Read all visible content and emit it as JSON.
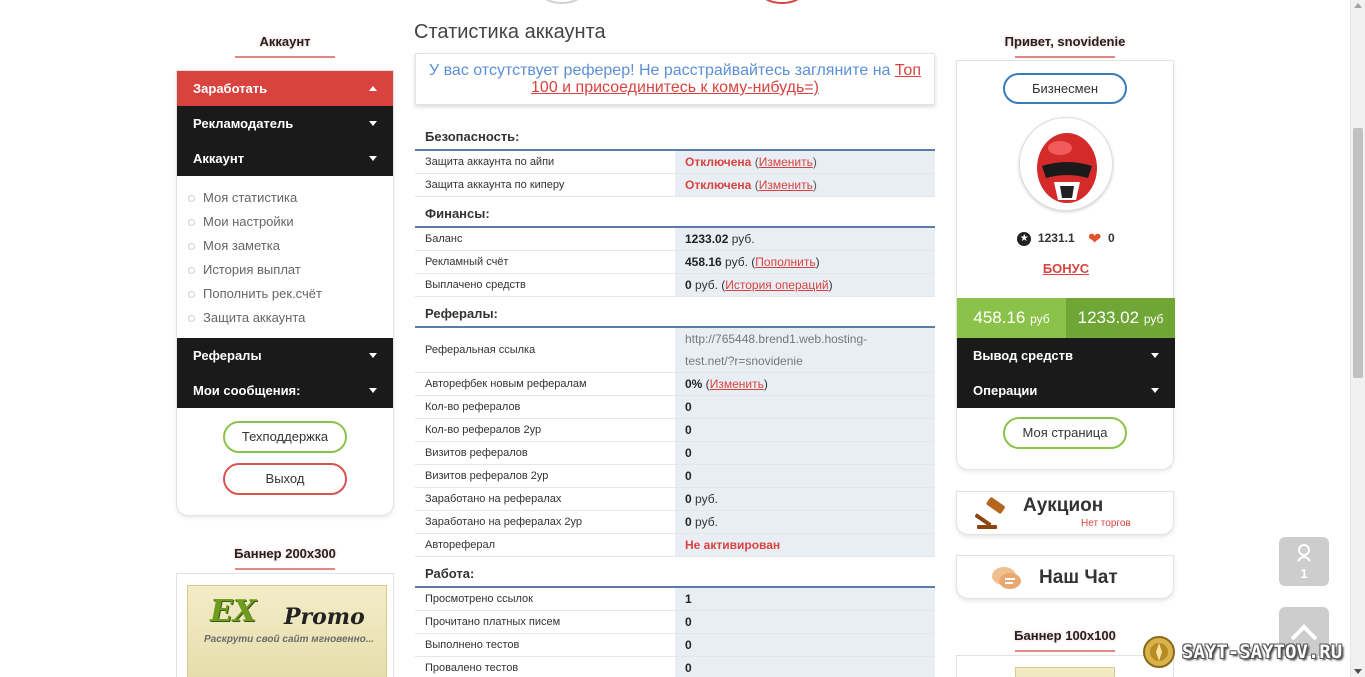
{
  "left": {
    "title": "Аккаунт",
    "menu": [
      {
        "label": "Заработать",
        "active": true
      },
      {
        "label": "Рекламодатель",
        "active": false
      },
      {
        "label": "Аккаунт",
        "active": false
      }
    ],
    "submenu": [
      "Моя статистика",
      "Мои настройки",
      "Моя заметка",
      "История выплат",
      "Пополнить рек.счёт",
      "Защита аккаунта"
    ],
    "menu2": [
      {
        "label": "Рефералы"
      },
      {
        "label": "Мои сообщения:"
      }
    ],
    "support_btn": "Техподдержка",
    "logout_btn": "Выход",
    "banner_title": "Баннер 200x300",
    "banner": {
      "ex": "EX",
      "promo": "Promo",
      "tagline": "Раскрути свой сайт мгновенно..."
    }
  },
  "center": {
    "title": "Статистика аккаунта",
    "notice_text": "У вас отсутствует реферер! Не расстрайвайтесь загляните на",
    "notice_link": "Топ 100 и присоединитесь к кому-нибудь=)",
    "security": {
      "title": "Безопасность:",
      "ip_label": "Защита аккаунта по айпи",
      "ip_status": "Отключена",
      "keeper_label": "Защита аккаунта по киперу",
      "keeper_status": "Отключена",
      "change": "Изменить"
    },
    "finance": {
      "title": "Финансы:",
      "balance_label": "Баланс",
      "balance_value": "1233.02",
      "ad_label": "Рекламный счёт",
      "ad_value": "458.16",
      "topup": "Пополнить",
      "paid_label": "Выплачено средств",
      "paid_value": "0",
      "history": "История операций",
      "currency": "руб."
    },
    "referrals": {
      "title": "Рефералы:",
      "link_label": "Реферальная ссылка",
      "link_line1": "http://765448.brend1.web.hosting-",
      "link_line2": "test.net/?r=snovidenie",
      "rows": [
        {
          "label": "Авторефбек новым рефералам",
          "value": "0%"
        },
        {
          "label": "Кол-во рефералов",
          "value": "0"
        },
        {
          "label": "Кол-во рефералов 2ур",
          "value": "0"
        },
        {
          "label": "Визитов рефералов",
          "value": "0"
        },
        {
          "label": "Визитов рефералов 2ур",
          "value": "0"
        },
        {
          "label": "Заработано на рефералах",
          "value": "0"
        },
        {
          "label": "Заработано на рефералах 2ур",
          "value": "0"
        }
      ],
      "autoref_label": "Автореферал",
      "autoref_status": "Не активирован"
    },
    "work": {
      "title": "Работа:",
      "rows": [
        {
          "label": "Просмотрено ссылок",
          "value": "1"
        },
        {
          "label": "Прочитано платных писем",
          "value": "0"
        },
        {
          "label": "Выполнено тестов",
          "value": "0"
        },
        {
          "label": "Провалено тестов",
          "value": "0"
        }
      ]
    }
  },
  "right": {
    "greeting": "Привет, snovidenie",
    "status_btn": "Бизнесмен",
    "rating": "1231.1",
    "likes": "0",
    "bonus": "БОНУС",
    "bal_ad": "458.16",
    "bal_main": "1233.02",
    "currency": "руб",
    "withdraw": "Вывод средств",
    "operations": "Операции",
    "my_page": "Моя страница",
    "auction_title": "Аукцион",
    "auction_sub": "Нет торгов",
    "chat_title": "Наш Чат",
    "banner100_title": "Баннер 100x100",
    "online_count": "1"
  },
  "watermark": "SAYT-SAYTOV.RU",
  "colors": {
    "accent_red": "#d9433f",
    "green": "#8bc34a",
    "dark_menu": "#1a1a1a",
    "link_blue": "#5b8fd6"
  }
}
